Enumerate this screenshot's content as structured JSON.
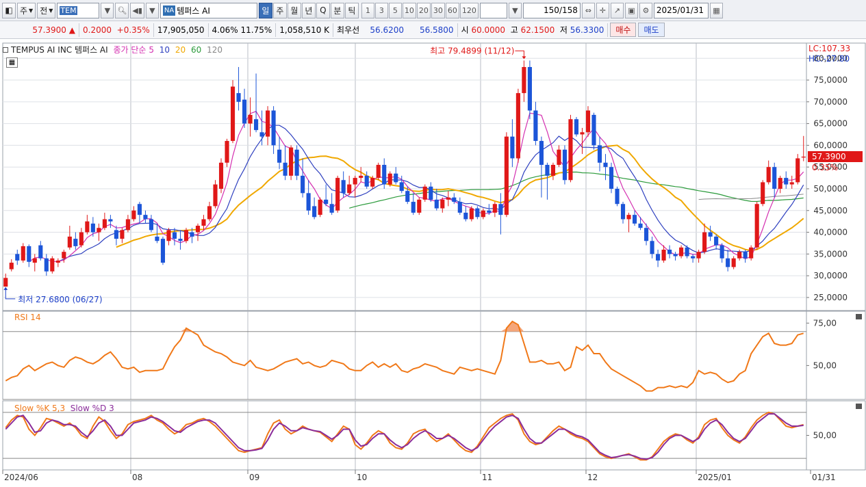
{
  "toolbar": {
    "type_label": "주",
    "market_label": "전",
    "code_value": "TEM",
    "na_badge": "NA",
    "stock_name": "템퍼스 AI",
    "periods": [
      "일",
      "주",
      "월",
      "년",
      "Q",
      "분",
      "틱"
    ],
    "active_period": "일",
    "intervals": [
      "1",
      "3",
      "5",
      "10",
      "20",
      "30",
      "60",
      "120"
    ],
    "count": "150",
    "total": "/158",
    "date": "2025/01/31"
  },
  "quote": {
    "price": "57.3900",
    "change_symbol": "▲",
    "change": "0.2000",
    "change_pct": "+0.35%",
    "volume": "17,905,050",
    "vol_pct1": "4.06%",
    "vol_pct2": "11.75%",
    "amount": "1,058,510 K",
    "best_label": "최우선",
    "ask": "56.6200",
    "bid": "56.5800",
    "open_label": "시",
    "open": "60.0000",
    "high_label": "고",
    "high": "62.1500",
    "low_label": "저",
    "low": "56.3300",
    "buy_label": "매수",
    "sell_label": "매도"
  },
  "legend": {
    "stock": "TEMPUS AI INC  템퍼스 AI",
    "ma_label": "종가 단순",
    "ma_periods": [
      "5",
      "10",
      "20",
      "60",
      "120"
    ],
    "lc": "LC:107.33",
    "hc": "HC:-27.80",
    "rsi_label": "RSI 14",
    "slow_k_label": "Slow %K 5,3",
    "slow_d_label": "Slow %D 3"
  },
  "annotations": {
    "max_label": "최고 79.4899 (11/12)",
    "min_label": "최저 27.6800 (06/27)",
    "price_tag": "57.3900",
    "price_pct": "0.35%"
  },
  "colors": {
    "up": "#e01818",
    "down": "#1c55d8",
    "ma5": "#d42fb0",
    "ma10": "#2d3fbf",
    "ma20": "#f0a800",
    "ma60": "#2a9a3a",
    "ma120": "#888888",
    "rsi": "#f07818",
    "slow_k": "#f07818",
    "slow_d": "#8a2c9a"
  },
  "chart_data": {
    "type": "candlestick",
    "price_ticks": [
      "80,0000",
      "75,0000",
      "70,0000",
      "65,0000",
      "60,0000",
      "55,0000",
      "50,0000",
      "45,0000",
      "40,0000",
      "35,0000",
      "30,0000",
      "25,0000"
    ],
    "rsi_ticks": [
      "75,00",
      "50,00"
    ],
    "stoch_ticks": [
      "50,00"
    ],
    "x_labels": [
      "2024/06",
      "08",
      "09",
      "10",
      "11",
      "12",
      "2025/01",
      "01/31"
    ],
    "price_range": [
      22.0,
      83.5
    ],
    "candles": [
      [
        27.5,
        30.5,
        27.68,
        29.5
      ],
      [
        31.5,
        33.8,
        31,
        33
      ],
      [
        35,
        36,
        32.5,
        33.5
      ],
      [
        33.5,
        37.5,
        33,
        36.8
      ],
      [
        36.8,
        37.2,
        32,
        33.2
      ],
      [
        33,
        35,
        31,
        34
      ],
      [
        37,
        38,
        33.5,
        34
      ],
      [
        34,
        35,
        30,
        31
      ],
      [
        31,
        34.5,
        30.5,
        34
      ],
      [
        33,
        34,
        32,
        33.5
      ],
      [
        34,
        36,
        33,
        35.5
      ],
      [
        36.5,
        41.5,
        36,
        39
      ],
      [
        38.5,
        40,
        36,
        36.8
      ],
      [
        37,
        41,
        36.5,
        40
      ],
      [
        40,
        44,
        39.5,
        42.5
      ],
      [
        42,
        43.5,
        39,
        40
      ],
      [
        40,
        42,
        38,
        41
      ],
      [
        41,
        44.5,
        40.5,
        43
      ],
      [
        43,
        44,
        41,
        42.5
      ],
      [
        40.5,
        41.5,
        37,
        38.5
      ],
      [
        38.5,
        41,
        37.5,
        40.5
      ],
      [
        40.5,
        44,
        40,
        43
      ],
      [
        43,
        46,
        42.5,
        45
      ],
      [
        46.5,
        47,
        42,
        44
      ],
      [
        44,
        45,
        42,
        43
      ],
      [
        43,
        44,
        40,
        40.5
      ],
      [
        39,
        42,
        37.5,
        38
      ],
      [
        38.5,
        39,
        32.5,
        33
      ],
      [
        38,
        41,
        37,
        40.5
      ],
      [
        40,
        41,
        37,
        38.5
      ],
      [
        38.5,
        40.5,
        36,
        38
      ],
      [
        38,
        41,
        37.5,
        40.5
      ],
      [
        40,
        41,
        37.5,
        39
      ],
      [
        40,
        42,
        38,
        41.5
      ],
      [
        41.5,
        44,
        40.5,
        43
      ],
      [
        43,
        47,
        42.5,
        46
      ],
      [
        46,
        52,
        45.5,
        51
      ],
      [
        50,
        57,
        49,
        56
      ],
      [
        56,
        61.5,
        55,
        61
      ],
      [
        61,
        75,
        60.5,
        73.5
      ],
      [
        72,
        78,
        68,
        70
      ],
      [
        70.5,
        73,
        64,
        65
      ],
      [
        65,
        71,
        62,
        67
      ],
      [
        66,
        76.5,
        63,
        63.5
      ],
      [
        63,
        68,
        60,
        62
      ],
      [
        62,
        69,
        60,
        68
      ],
      [
        68,
        69,
        58,
        60
      ],
      [
        59,
        62,
        54.5,
        56
      ],
      [
        56,
        60,
        52,
        53
      ],
      [
        53,
        60,
        52,
        59.5
      ],
      [
        59,
        60,
        52,
        53
      ],
      [
        53,
        57,
        48,
        49
      ],
      [
        49,
        52,
        44,
        45
      ],
      [
        46,
        48,
        43,
        43.5
      ],
      [
        44,
        48,
        43.5,
        47.5
      ],
      [
        47.5,
        51,
        46,
        46.5
      ],
      [
        46.5,
        49,
        44,
        44.5
      ],
      [
        45,
        53,
        44.5,
        52.5
      ],
      [
        52,
        54,
        48,
        49
      ],
      [
        49,
        53,
        48.5,
        51
      ],
      [
        51,
        53,
        48,
        52.5
      ],
      [
        52.5,
        55,
        51.5,
        53
      ],
      [
        53,
        54,
        50,
        50.5
      ],
      [
        50.5,
        53,
        50,
        52.5
      ],
      [
        52.5,
        56,
        52,
        55.5
      ],
      [
        55.5,
        57,
        50,
        51
      ],
      [
        51,
        54,
        50.5,
        53.5
      ],
      [
        53.5,
        55,
        51,
        51.5
      ],
      [
        51.5,
        53,
        49,
        49.5
      ],
      [
        49.5,
        50.5,
        46.5,
        47
      ],
      [
        47,
        49,
        44,
        44.5
      ],
      [
        44.5,
        48,
        44,
        47.5
      ],
      [
        47.5,
        51,
        47,
        50.5
      ],
      [
        50.5,
        51.5,
        47,
        47.5
      ],
      [
        47.5,
        50,
        45,
        45.5
      ],
      [
        45.5,
        48,
        44.5,
        47.5
      ],
      [
        47.5,
        49.5,
        46,
        48
      ],
      [
        48,
        49,
        46.5,
        47
      ],
      [
        47,
        48,
        44,
        44.5
      ],
      [
        44.5,
        46,
        42.5,
        43
      ],
      [
        43,
        46,
        42.5,
        45.5
      ],
      [
        45.5,
        46,
        43,
        43.5
      ],
      [
        43.5,
        45.5,
        43,
        45
      ],
      [
        45,
        46.5,
        44,
        44.5
      ],
      [
        44.5,
        47,
        43.5,
        46.5
      ],
      [
        46.5,
        49,
        39.5,
        44
      ],
      [
        44,
        63,
        43.5,
        62
      ],
      [
        62,
        66,
        55,
        57
      ],
      [
        57,
        73,
        56,
        72
      ],
      [
        72,
        79.5,
        70,
        78
      ],
      [
        78,
        79.49,
        66,
        68
      ],
      [
        68,
        70,
        60,
        61
      ],
      [
        61,
        62,
        48,
        55.5
      ],
      [
        55.5,
        56,
        47.5,
        53
      ],
      [
        53,
        56,
        52,
        55.5
      ],
      [
        55.5,
        60,
        55,
        59
      ],
      [
        59,
        60,
        51,
        52
      ],
      [
        52,
        67,
        51.5,
        66
      ],
      [
        66,
        66.5,
        62,
        62.5
      ],
      [
        62.5,
        64,
        58,
        63
      ],
      [
        63,
        69,
        62,
        68
      ],
      [
        67,
        67.5,
        59,
        60
      ],
      [
        60,
        62,
        54,
        56
      ],
      [
        56,
        58,
        52,
        55
      ],
      [
        55,
        56,
        49,
        50
      ],
      [
        50,
        50.5,
        46,
        46.5
      ],
      [
        46.5,
        47,
        42,
        43
      ],
      [
        43,
        44.5,
        40,
        44
      ],
      [
        44,
        45,
        41.5,
        42
      ],
      [
        42,
        43.5,
        40.5,
        41
      ],
      [
        41,
        42,
        37,
        38
      ],
      [
        38,
        39,
        34,
        35
      ],
      [
        35,
        36,
        32,
        33.5
      ],
      [
        33.5,
        37,
        33,
        36
      ],
      [
        36,
        37,
        34,
        35
      ],
      [
        35,
        35.5,
        33.5,
        34.5
      ],
      [
        34.5,
        37,
        34,
        36.5
      ],
      [
        36.5,
        37,
        34,
        34.5
      ],
      [
        34.5,
        35,
        33,
        34
      ],
      [
        34,
        36,
        33,
        35.5
      ],
      [
        35.5,
        42,
        35,
        40
      ],
      [
        40,
        41.5,
        38,
        39
      ],
      [
        39,
        39.5,
        36,
        37
      ],
      [
        37,
        37.5,
        33,
        34
      ],
      [
        34,
        36,
        31,
        32
      ],
      [
        32,
        34.5,
        31.5,
        34
      ],
      [
        34,
        36,
        33.5,
        35.5
      ],
      [
        35.5,
        36,
        33,
        34
      ],
      [
        34,
        37,
        33.5,
        36.5
      ],
      [
        36.5,
        47,
        36,
        46.5
      ],
      [
        46.5,
        52,
        46,
        51.5
      ],
      [
        51.5,
        56.5,
        51,
        55
      ],
      [
        55,
        56,
        48,
        50
      ],
      [
        50,
        53,
        49,
        52.5
      ],
      [
        52.5,
        54,
        50,
        51
      ],
      [
        51,
        53,
        50,
        51.5
      ],
      [
        51.5,
        58,
        51,
        57
      ],
      [
        57.19,
        62.15,
        56.33,
        57.39
      ]
    ],
    "rsi_values": [
      41,
      43,
      44,
      48,
      50,
      47,
      49,
      51,
      52,
      50,
      49,
      53,
      55,
      54,
      52,
      51,
      53,
      56,
      58,
      54,
      49,
      48,
      49,
      46,
      47,
      47,
      47,
      48,
      55,
      61,
      65,
      72,
      70,
      68,
      62,
      60,
      58,
      57,
      55,
      52,
      51,
      50,
      53,
      49,
      48,
      47,
      48,
      50,
      52,
      53,
      54,
      51,
      52,
      50,
      49,
      50,
      53,
      52,
      51,
      48,
      47,
      47,
      50,
      52,
      49,
      51,
      49,
      51,
      47,
      46,
      48,
      49,
      51,
      50,
      49,
      47,
      46,
      45,
      49,
      48,
      47,
      48,
      47,
      46,
      45,
      53,
      72,
      76,
      74,
      63,
      52,
      52,
      53,
      51,
      51,
      52,
      47,
      49,
      61,
      59,
      62,
      57,
      57,
      52,
      48,
      46,
      44,
      42,
      40,
      38,
      35,
      35,
      37,
      37,
      38,
      37,
      38,
      37,
      40,
      47,
      45,
      46,
      45,
      42,
      40,
      41,
      45,
      47,
      57,
      62,
      67,
      69,
      63,
      62,
      62,
      63,
      68,
      69
    ],
    "slow_k": [
      60,
      70,
      76,
      74,
      58,
      50,
      60,
      72,
      70,
      66,
      62,
      66,
      60,
      50,
      46,
      62,
      74,
      68,
      56,
      46,
      52,
      64,
      68,
      70,
      72,
      76,
      70,
      66,
      58,
      52,
      56,
      64,
      66,
      70,
      72,
      68,
      62,
      54,
      46,
      38,
      30,
      28,
      30,
      32,
      34,
      52,
      66,
      70,
      58,
      52,
      56,
      62,
      58,
      56,
      54,
      48,
      42,
      52,
      62,
      58,
      38,
      32,
      40,
      50,
      56,
      52,
      40,
      34,
      32,
      40,
      52,
      56,
      58,
      48,
      42,
      46,
      52,
      44,
      36,
      30,
      28,
      36,
      48,
      60,
      66,
      72,
      76,
      78,
      70,
      52,
      42,
      38,
      40,
      48,
      56,
      62,
      58,
      52,
      48,
      46,
      42,
      34,
      26,
      22,
      20,
      22,
      24,
      26,
      22,
      18,
      18,
      22,
      32,
      42,
      48,
      52,
      50,
      44,
      40,
      48,
      64,
      70,
      72,
      60,
      50,
      44,
      40,
      48,
      60,
      70,
      76,
      80,
      78,
      70,
      62,
      60,
      62,
      64
    ],
    "slow_d": [
      58,
      66,
      74,
      76,
      66,
      54,
      56,
      66,
      70,
      68,
      64,
      64,
      62,
      54,
      48,
      56,
      66,
      70,
      62,
      50,
      50,
      58,
      66,
      68,
      70,
      74,
      72,
      68,
      62,
      56,
      54,
      60,
      64,
      68,
      70,
      70,
      66,
      58,
      50,
      42,
      34,
      30,
      30,
      31,
      33,
      44,
      58,
      66,
      62,
      56,
      56,
      60,
      58,
      56,
      55,
      50,
      45,
      50,
      58,
      58,
      44,
      36,
      38,
      46,
      52,
      52,
      44,
      38,
      34,
      38,
      46,
      52,
      56,
      52,
      46,
      46,
      50,
      46,
      40,
      34,
      30,
      34,
      44,
      54,
      62,
      68,
      74,
      76,
      72,
      58,
      46,
      40,
      40,
      46,
      52,
      58,
      58,
      54,
      50,
      48,
      44,
      36,
      28,
      24,
      21,
      22,
      24,
      25,
      23,
      20,
      19,
      21,
      28,
      38,
      46,
      50,
      50,
      46,
      42,
      46,
      58,
      66,
      70,
      64,
      54,
      46,
      42,
      46,
      56,
      66,
      72,
      78,
      78,
      72,
      66,
      62,
      62,
      63
    ]
  }
}
